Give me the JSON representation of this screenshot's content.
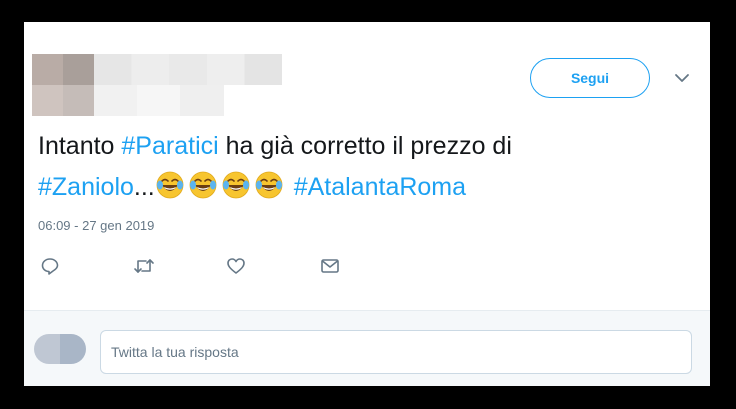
{
  "follow_button": {
    "label": "Segui"
  },
  "tweet": {
    "text_prefix": "Intanto ",
    "hashtag1": "#Paratici",
    "text_middle": " ha già corretto il prezzo di",
    "hashtag2": "#Zaniolo",
    "ellipsis": "...",
    "emoji_count": 4,
    "emoji_name": "face-with-tears-of-joy",
    "hashtag3": "#AtalantaRoma",
    "timestamp": "06:09 - 27 gen 2019"
  },
  "actions": [
    {
      "icon": "reply-icon"
    },
    {
      "icon": "retweet-icon"
    },
    {
      "icon": "like-icon"
    },
    {
      "icon": "direct-message-icon"
    }
  ],
  "reply": {
    "placeholder": "Twitta la tua risposta"
  },
  "colors": {
    "accent": "#1da1f2",
    "text": "#14171a",
    "muted": "#657786"
  }
}
